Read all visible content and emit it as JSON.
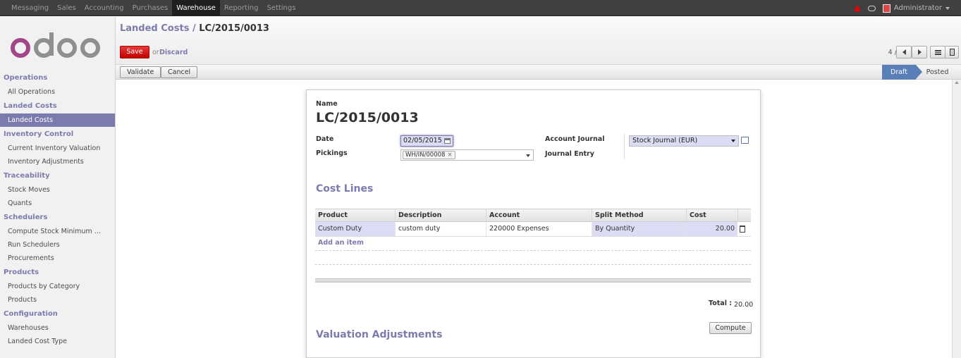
{
  "topbar": {
    "menu": [
      "Messaging",
      "Sales",
      "Accounting",
      "Purchases",
      "Warehouse",
      "Reporting",
      "Settings"
    ],
    "active": "Warehouse",
    "user": "Administrator",
    "icons": [
      "alert-icon",
      "chat-icon",
      "avatar"
    ]
  },
  "sidebar": {
    "logo": "odoo",
    "sections": [
      {
        "title": "Operations",
        "items": [
          "All Operations"
        ]
      },
      {
        "title": "Landed Costs",
        "items": [
          "Landed Costs"
        ]
      },
      {
        "title": "Inventory Control",
        "items": [
          "Current Inventory Valuation",
          "Inventory Adjustments"
        ]
      },
      {
        "title": "Traceability",
        "items": [
          "Stock Moves",
          "Quants"
        ]
      },
      {
        "title": "Schedulers",
        "items": [
          "Compute Stock Minimum ...",
          "Run Schedulers",
          "Procurements"
        ]
      },
      {
        "title": "Products",
        "items": [
          "Products by Category",
          "Products"
        ]
      },
      {
        "title": "Configuration",
        "items": [
          "Warehouses",
          "Landed Cost Type"
        ]
      }
    ],
    "active_item": "Landed Costs"
  },
  "header": {
    "breadcrumb_parent": "Landed Costs",
    "breadcrumb_sep": "/",
    "breadcrumb_current": "LC/2015/0013",
    "save": "Save",
    "or": "or",
    "discard": "Discard",
    "pager": "4 / 4"
  },
  "statusbar": {
    "validate": "Validate",
    "cancel": "Cancel",
    "stages": [
      "Draft",
      "Posted"
    ],
    "current_stage": "Draft"
  },
  "form": {
    "name_label": "Name",
    "name": "LC/2015/0013",
    "date_label": "Date",
    "date": "02/05/2015",
    "pickings_label": "Pickings",
    "picking_tag": "WH/IN/00008",
    "tag_remove": "×",
    "account_journal_label": "Account Journal",
    "account_journal": "Stock Journal (EUR)",
    "journal_entry_label": "Journal Entry",
    "journal_entry": ""
  },
  "cost_lines": {
    "title": "Cost Lines",
    "columns": [
      "Product",
      "Description",
      "Account",
      "Split Method",
      "Cost"
    ],
    "rows": [
      {
        "product": "Custom Duty",
        "description": "custom duty",
        "account": "220000 Expenses",
        "split_method": "By Quantity",
        "cost": "20.00"
      }
    ],
    "add_item": "Add an item",
    "total_label": "Total :",
    "total": "20.00",
    "compute": "Compute"
  },
  "valuation": {
    "title": "Valuation Adjustments"
  },
  "colors": {
    "accent": "#7c7bad",
    "topbar": "#404040",
    "save": "#d01c1c",
    "stage_active": "#5a7fb8",
    "required_field": "#dcdcf5"
  }
}
